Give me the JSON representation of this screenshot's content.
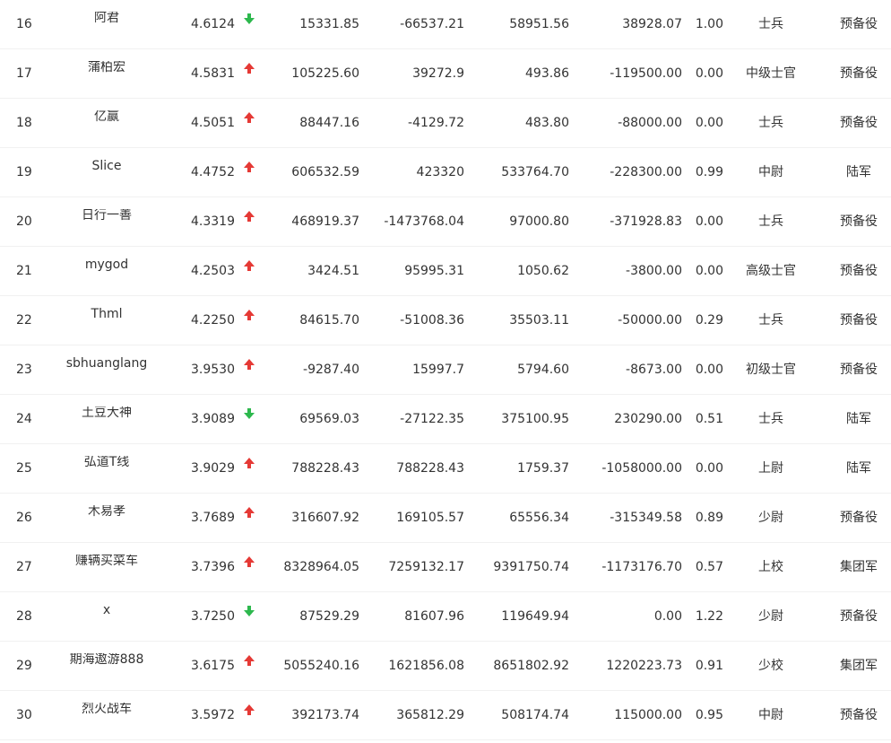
{
  "colors": {
    "up": "#e53935",
    "down": "#2db84d",
    "text": "#333333"
  },
  "rows": [
    {
      "rank": "16",
      "name": "阿君",
      "score": "4.6124",
      "trend": "down",
      "v1": "15331.85",
      "v2": "-66537.21",
      "v3": "58951.56",
      "v4": "38928.07",
      "ratio": "1.00",
      "rank_title": "士兵",
      "unit": "预备役"
    },
    {
      "rank": "17",
      "name": "蒲柏宏",
      "score": "4.5831",
      "trend": "up",
      "v1": "105225.60",
      "v2": "39272.9",
      "v3": "493.86",
      "v4": "-119500.00",
      "ratio": "0.00",
      "rank_title": "中级士官",
      "unit": "预备役"
    },
    {
      "rank": "18",
      "name": "亿赢",
      "score": "4.5051",
      "trend": "up",
      "v1": "88447.16",
      "v2": "-4129.72",
      "v3": "483.80",
      "v4": "-88000.00",
      "ratio": "0.00",
      "rank_title": "士兵",
      "unit": "预备役"
    },
    {
      "rank": "19",
      "name": "Slice",
      "score": "4.4752",
      "trend": "up",
      "v1": "606532.59",
      "v2": "423320",
      "v3": "533764.70",
      "v4": "-228300.00",
      "ratio": "0.99",
      "rank_title": "中尉",
      "unit": "陆军"
    },
    {
      "rank": "20",
      "name": "日行一善",
      "score": "4.3319",
      "trend": "up",
      "v1": "468919.37",
      "v2": "-1473768.04",
      "v3": "97000.80",
      "v4": "-371928.83",
      "ratio": "0.00",
      "rank_title": "士兵",
      "unit": "预备役"
    },
    {
      "rank": "21",
      "name": "mygod",
      "score": "4.2503",
      "trend": "up",
      "v1": "3424.51",
      "v2": "95995.31",
      "v3": "1050.62",
      "v4": "-3800.00",
      "ratio": "0.00",
      "rank_title": "高级士官",
      "unit": "预备役"
    },
    {
      "rank": "22",
      "name": "Thml",
      "score": "4.2250",
      "trend": "up",
      "v1": "84615.70",
      "v2": "-51008.36",
      "v3": "35503.11",
      "v4": "-50000.00",
      "ratio": "0.29",
      "rank_title": "士兵",
      "unit": "预备役"
    },
    {
      "rank": "23",
      "name": "sbhuanglang",
      "score": "3.9530",
      "trend": "up",
      "v1": "-9287.40",
      "v2": "15997.7",
      "v3": "5794.60",
      "v4": "-8673.00",
      "ratio": "0.00",
      "rank_title": "初级士官",
      "unit": "预备役"
    },
    {
      "rank": "24",
      "name": "土豆大神",
      "score": "3.9089",
      "trend": "down",
      "v1": "69569.03",
      "v2": "-27122.35",
      "v3": "375100.95",
      "v4": "230290.00",
      "ratio": "0.51",
      "rank_title": "士兵",
      "unit": "陆军"
    },
    {
      "rank": "25",
      "name": "弘道T线",
      "score": "3.9029",
      "trend": "up",
      "v1": "788228.43",
      "v2": "788228.43",
      "v3": "1759.37",
      "v4": "-1058000.00",
      "ratio": "0.00",
      "rank_title": "上尉",
      "unit": "陆军"
    },
    {
      "rank": "26",
      "name": "木易孝",
      "score": "3.7689",
      "trend": "up",
      "v1": "316607.92",
      "v2": "169105.57",
      "v3": "65556.34",
      "v4": "-315349.58",
      "ratio": "0.89",
      "rank_title": "少尉",
      "unit": "预备役"
    },
    {
      "rank": "27",
      "name": "赚辆买菜车",
      "score": "3.7396",
      "trend": "up",
      "v1": "8328964.05",
      "v2": "7259132.17",
      "v3": "9391750.74",
      "v4": "-1173176.70",
      "ratio": "0.57",
      "rank_title": "上校",
      "unit": "集团军"
    },
    {
      "rank": "28",
      "name": "x",
      "score": "3.7250",
      "trend": "down",
      "v1": "87529.29",
      "v2": "81607.96",
      "v3": "119649.94",
      "v4": "0.00",
      "ratio": "1.22",
      "rank_title": "少尉",
      "unit": "预备役"
    },
    {
      "rank": "29",
      "name": "期海遨游888",
      "score": "3.6175",
      "trend": "up",
      "v1": "5055240.16",
      "v2": "1621856.08",
      "v3": "8651802.92",
      "v4": "1220223.73",
      "ratio": "0.91",
      "rank_title": "少校",
      "unit": "集团军"
    },
    {
      "rank": "30",
      "name": "烈火战车",
      "score": "3.5972",
      "trend": "up",
      "v1": "392173.74",
      "v2": "365812.29",
      "v3": "508174.74",
      "v4": "115000.00",
      "ratio": "0.95",
      "rank_title": "中尉",
      "unit": "预备役"
    }
  ]
}
